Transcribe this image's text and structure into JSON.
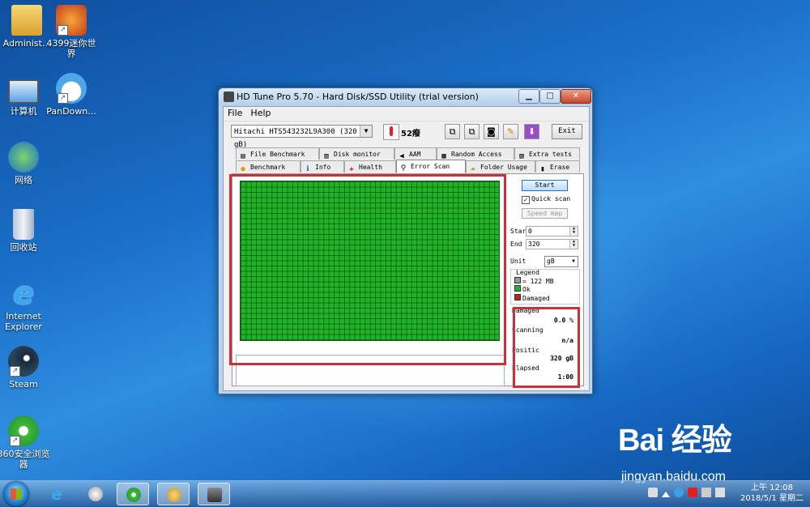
{
  "desktop": {
    "icons": [
      {
        "label": "Administ...",
        "icon": "user-folder-icon"
      },
      {
        "label": "4399迷你世界",
        "icon": "game-icon"
      },
      {
        "label": "计算机",
        "icon": "computer-icon"
      },
      {
        "label": "PanDown...",
        "icon": "cloud-icon"
      },
      {
        "label": "网络",
        "icon": "network-icon"
      },
      {
        "label": "回收站",
        "icon": "recycle-bin-icon"
      },
      {
        "label": "Internet Explorer",
        "icon": "ie-icon"
      },
      {
        "label": "Steam",
        "icon": "steam-icon"
      },
      {
        "label": "360安全浏览器",
        "icon": "browser-360-icon"
      }
    ]
  },
  "window": {
    "title": "HD Tune Pro 5.70 - Hard Disk/SSD Utility (trial version)",
    "menu": [
      "File",
      "Help"
    ],
    "drive": "Hitachi HTS543232L9A300 (320 gB)",
    "temperature": "52癈",
    "exit_label": "Exit",
    "tabs_row1": [
      {
        "label": "File Benchmark",
        "icon": "file-benchmark-icon"
      },
      {
        "label": "Disk monitor",
        "icon": "disk-monitor-icon"
      },
      {
        "label": "AAM",
        "icon": "speaker-icon"
      },
      {
        "label": "Random Access",
        "icon": "random-access-icon"
      },
      {
        "label": "Extra tests",
        "icon": "extra-tests-icon"
      }
    ],
    "tabs_row2": [
      {
        "label": "Benchmark",
        "icon": "benchmark-icon"
      },
      {
        "label": "Info",
        "icon": "info-icon"
      },
      {
        "label": "Health",
        "icon": "health-icon"
      },
      {
        "label": "Error Scan",
        "icon": "magnifier-icon",
        "active": true
      },
      {
        "label": "Folder Usage",
        "icon": "folder-icon"
      },
      {
        "label": "Erase",
        "icon": "trash-icon"
      }
    ],
    "scan": {
      "start_label": "Start",
      "quick_scan_label": "Quick scan",
      "quick_scan_checked": true,
      "speed_map_label": "Speed map",
      "start_field_label": "Star",
      "start_value": "0",
      "end_field_label": "End",
      "end_value": "320",
      "unit_label": "Unit",
      "unit_value": "gB",
      "legend_title": "Legend",
      "legend_block": "= 122 MB",
      "legend_ok": "Ok",
      "legend_damaged": "Damaged",
      "damaged_label": "Damaged",
      "damaged_value": "0.0 %",
      "scanning_label": "Scanning",
      "scanning_value": "n/a",
      "position_label": "Positic",
      "position_value": "320 gB",
      "elapsed_label": "Elapsed",
      "elapsed_value": "1:00"
    }
  },
  "taskbar": {
    "clock_time": "上午 12:08",
    "clock_date": "2018/5/1 星期二"
  },
  "watermark": {
    "brand": "Bai 经验",
    "url": "jingyan.baidu.com"
  },
  "colors": {
    "ok_block": "#22b22a",
    "damaged_block": "#c8201e",
    "highlight": "#c8323c"
  }
}
